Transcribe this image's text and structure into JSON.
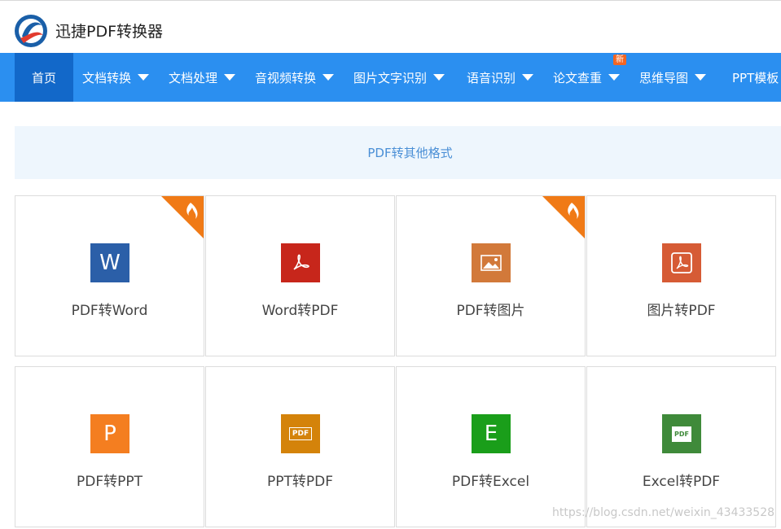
{
  "app": {
    "title": "迅捷PDF转换器"
  },
  "nav": {
    "items": [
      {
        "label": "首页",
        "active": true,
        "dropdown": false
      },
      {
        "label": "文档转换",
        "dropdown": true
      },
      {
        "label": "文档处理",
        "dropdown": true
      },
      {
        "label": "音视频转换",
        "dropdown": true
      },
      {
        "label": "图片文字识别",
        "dropdown": true
      },
      {
        "label": "语音识别",
        "dropdown": true
      },
      {
        "label": "论文查重",
        "dropdown": true,
        "badge": "新"
      },
      {
        "label": "思维导图",
        "dropdown": true
      },
      {
        "label": "PPT模板",
        "dropdown": false
      }
    ]
  },
  "section": {
    "title": "PDF转其他格式"
  },
  "cards": [
    {
      "label": "PDF转Word",
      "icon": "word-icon",
      "glyph": "W",
      "color": "#2b5fa8",
      "hot": true
    },
    {
      "label": "Word转PDF",
      "icon": "pdf-icon",
      "glyph": "",
      "color": "#c7261b",
      "hot": false
    },
    {
      "label": "PDF转图片",
      "icon": "image-icon",
      "glyph": "",
      "color": "#d2793a",
      "hot": true
    },
    {
      "label": "图片转PDF",
      "icon": "pdf-box-icon",
      "glyph": "",
      "color": "#d65b35",
      "hot": false
    },
    {
      "label": "PDF转PPT",
      "icon": "ppt-icon",
      "glyph": "P",
      "color": "#f47e20",
      "hot": false
    },
    {
      "label": "PPT转PDF",
      "icon": "ppt-pdf-icon",
      "glyph": "PDF",
      "color": "#d4830a",
      "hot": false
    },
    {
      "label": "PDF转Excel",
      "icon": "excel-icon",
      "glyph": "E",
      "color": "#1a9e1a",
      "hot": false
    },
    {
      "label": "Excel转PDF",
      "icon": "excel-pdf-icon",
      "glyph": "PDF",
      "color": "#3f8a3a",
      "hot": false
    }
  ],
  "watermark": "https://blog.csdn.net/weixin_43433528"
}
